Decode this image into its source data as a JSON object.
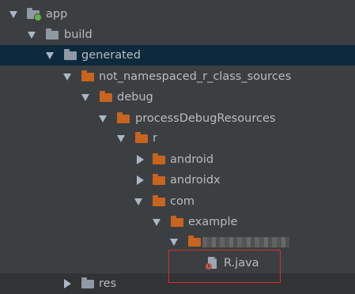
{
  "tree": {
    "app": "app",
    "build": "build",
    "generated": "generated",
    "not_namespaced": "not_namespaced_r_class_sources",
    "debug": "debug",
    "processDebugResources": "processDebugResources",
    "r": "r",
    "android": "android",
    "androidx": "androidx",
    "com": "com",
    "example": "example",
    "r_java": "R.java",
    "res": "res"
  },
  "colors": {
    "background": "#3c3f41",
    "selected_row": "#0d293e",
    "folder_source": "#c8641e",
    "folder_plain": "#8f99a3",
    "highlight_box": "#d32f2f"
  }
}
